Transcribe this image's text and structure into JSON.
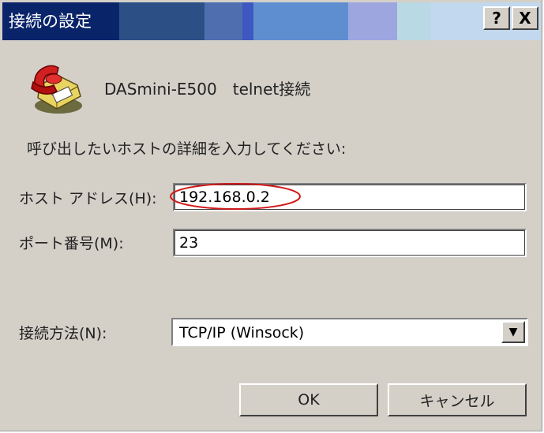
{
  "window": {
    "title": "接続の設定",
    "help_btn": "?",
    "close_btn": "X"
  },
  "connection": {
    "name": "DASmini-E500　telnet接続",
    "icon": "telephone-icon"
  },
  "prompt": "呼び出したいホストの詳細を入力してください:",
  "fields": {
    "host_label": "ホスト アドレス(H):",
    "host_value": "192.168.0.2",
    "port_label": "ポート番号(M):",
    "port_value": "23",
    "method_label": "接続方法(N):",
    "method_value": "TCP/IP (Winsock)"
  },
  "buttons": {
    "ok": "OK",
    "cancel": "キャンセル"
  },
  "colors": {
    "title_gradient": [
      "#0a246a",
      "#3a6ea5",
      "#6a5acd",
      "#a6caf0",
      "#b8d4e8"
    ],
    "annotation": "#d01818"
  }
}
